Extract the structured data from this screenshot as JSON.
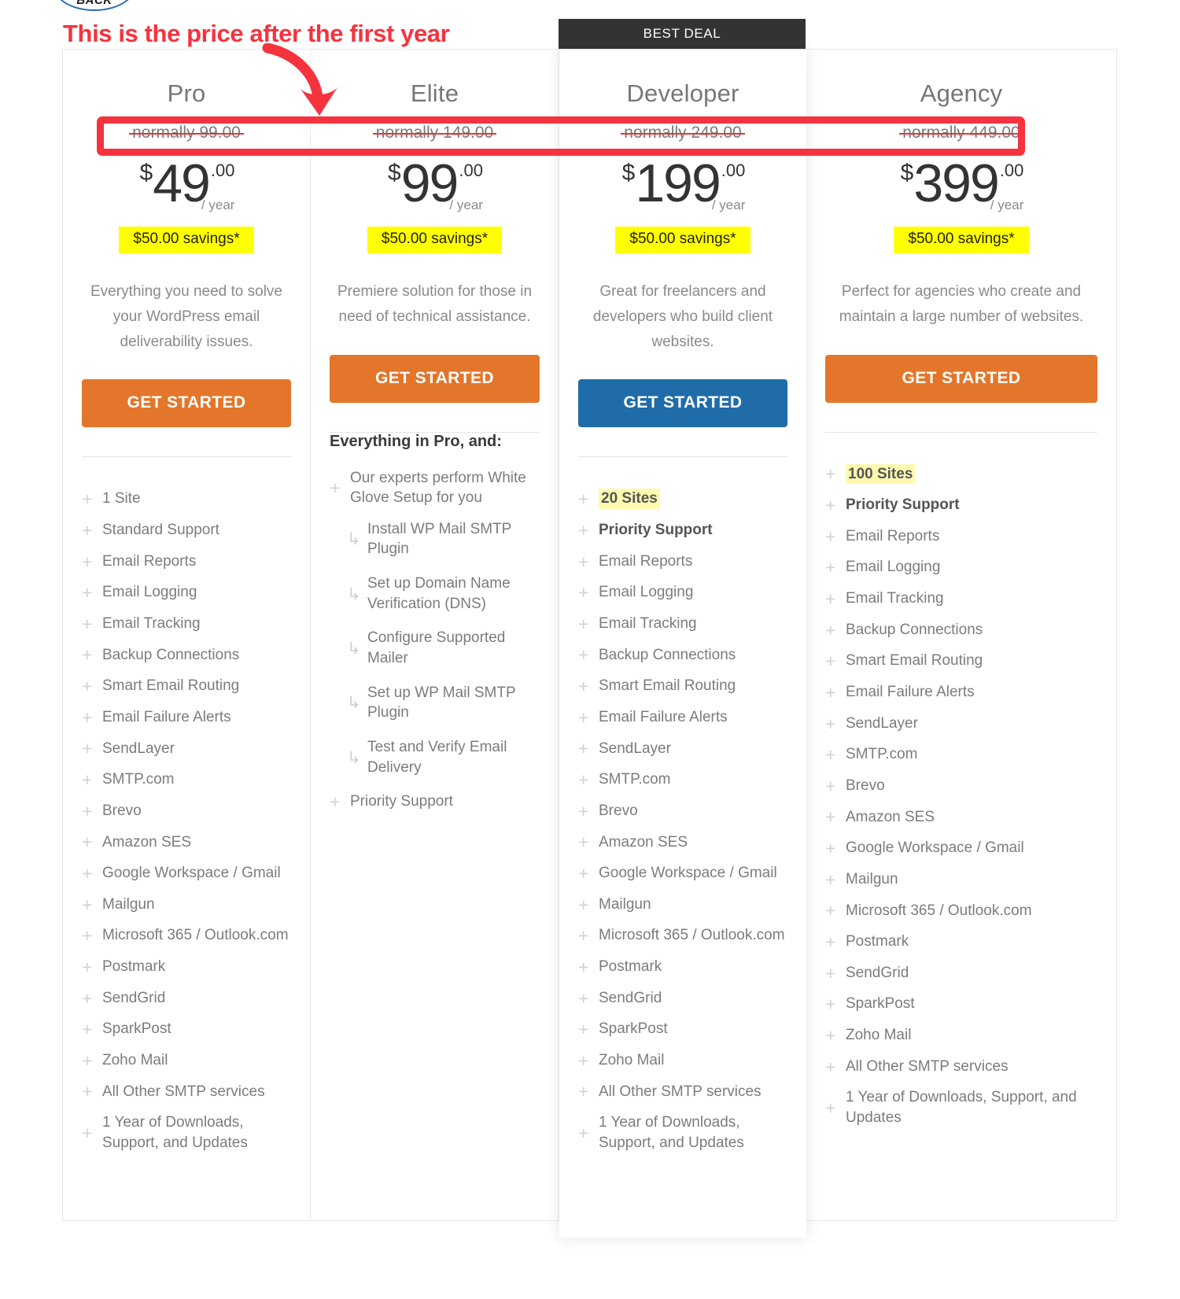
{
  "annotations": {
    "headline": "This is the price after the first year",
    "headline_color": "#f5333f",
    "badge_text": "BACK",
    "arrow_icon": "curved-down-arrow-icon",
    "rect_icon": "highlight-rectangle-icon"
  },
  "best_deal": {
    "label": "BEST DEAL",
    "background": "#333333"
  },
  "colors": {
    "cta_orange": "#e3762b",
    "cta_blue": "#1f6ca8",
    "savings_highlight": "#ffff00",
    "sites_highlight": "#fdfab0",
    "annotation_red": "#f5333f"
  },
  "plans": [
    {
      "name": "Pro",
      "normally": "normally 99.00",
      "currency": "$",
      "amount": "49",
      "cents": ".00",
      "period": "/ year",
      "savings": "$50.00 savings*",
      "description": "Everything you need to solve your WordPress email deliverability issues.",
      "cta_label": "GET STARTED",
      "cta_style": "orange",
      "features_heading": "",
      "features": [
        {
          "text": "1 Site",
          "icon": "plus-icon",
          "style": "normal"
        },
        {
          "text": "Standard Support",
          "icon": "plus-icon",
          "style": "normal"
        },
        {
          "text": "Email Reports",
          "icon": "plus-icon",
          "style": "normal"
        },
        {
          "text": "Email Logging",
          "icon": "plus-icon",
          "style": "normal"
        },
        {
          "text": "Email Tracking",
          "icon": "plus-icon",
          "style": "normal"
        },
        {
          "text": "Backup Connections",
          "icon": "plus-icon",
          "style": "normal"
        },
        {
          "text": "Smart Email Routing",
          "icon": "plus-icon",
          "style": "normal"
        },
        {
          "text": "Email Failure Alerts",
          "icon": "plus-icon",
          "style": "normal"
        },
        {
          "text": "SendLayer",
          "icon": "plus-icon",
          "style": "normal"
        },
        {
          "text": "SMTP.com",
          "icon": "plus-icon",
          "style": "normal"
        },
        {
          "text": "Brevo",
          "icon": "plus-icon",
          "style": "normal"
        },
        {
          "text": "Amazon SES",
          "icon": "plus-icon",
          "style": "normal"
        },
        {
          "text": "Google Workspace / Gmail",
          "icon": "plus-icon",
          "style": "normal"
        },
        {
          "text": "Mailgun",
          "icon": "plus-icon",
          "style": "normal"
        },
        {
          "text": "Microsoft 365 / Outlook.com",
          "icon": "plus-icon",
          "style": "normal"
        },
        {
          "text": "Postmark",
          "icon": "plus-icon",
          "style": "normal"
        },
        {
          "text": "SendGrid",
          "icon": "plus-icon",
          "style": "normal"
        },
        {
          "text": "SparkPost",
          "icon": "plus-icon",
          "style": "normal"
        },
        {
          "text": "Zoho Mail",
          "icon": "plus-icon",
          "style": "normal"
        },
        {
          "text": "All Other SMTP services",
          "icon": "plus-icon",
          "style": "normal"
        },
        {
          "text": "1 Year of Downloads, Support, and Updates",
          "icon": "plus-icon",
          "style": "normal"
        }
      ]
    },
    {
      "name": "Elite",
      "normally": "normally 149.00",
      "currency": "$",
      "amount": "99",
      "cents": ".00",
      "period": "/ year",
      "savings": "$50.00 savings*",
      "description": "Premiere solution for those in need of technical assistance.",
      "cta_label": "GET STARTED",
      "cta_style": "orange",
      "features_heading": "Everything in Pro, and:",
      "features": [
        {
          "text": "Our experts perform White Glove Setup for you",
          "icon": "plus-icon",
          "style": "normal"
        },
        {
          "text": "Install WP Mail SMTP Plugin",
          "icon": "arrow-sub-icon",
          "style": "sub"
        },
        {
          "text": "Set up Domain Name Verification (DNS)",
          "icon": "arrow-sub-icon",
          "style": "sub"
        },
        {
          "text": "Configure Supported Mailer",
          "icon": "arrow-sub-icon",
          "style": "sub"
        },
        {
          "text": "Set up WP Mail SMTP Plugin",
          "icon": "arrow-sub-icon",
          "style": "sub"
        },
        {
          "text": "Test and Verify Email Delivery",
          "icon": "arrow-sub-icon",
          "style": "sub"
        },
        {
          "text": "Priority Support",
          "icon": "plus-icon",
          "style": "normal"
        }
      ]
    },
    {
      "name": "Developer",
      "normally": "normally 249.00",
      "currency": "$",
      "amount": "199",
      "cents": ".00",
      "period": "/ year",
      "savings": "$50.00 savings*",
      "description": "Great for freelancers and developers who build client websites.",
      "cta_label": "GET STARTED",
      "cta_style": "blue",
      "features_heading": "",
      "features": [
        {
          "text": "20 Sites",
          "icon": "plus-icon",
          "style": "highlight"
        },
        {
          "text": "Priority Support",
          "icon": "plus-icon",
          "style": "bold"
        },
        {
          "text": "Email Reports",
          "icon": "plus-icon",
          "style": "normal"
        },
        {
          "text": "Email Logging",
          "icon": "plus-icon",
          "style": "normal"
        },
        {
          "text": "Email Tracking",
          "icon": "plus-icon",
          "style": "normal"
        },
        {
          "text": "Backup Connections",
          "icon": "plus-icon",
          "style": "normal"
        },
        {
          "text": "Smart Email Routing",
          "icon": "plus-icon",
          "style": "normal"
        },
        {
          "text": "Email Failure Alerts",
          "icon": "plus-icon",
          "style": "normal"
        },
        {
          "text": "SendLayer",
          "icon": "plus-icon",
          "style": "normal"
        },
        {
          "text": "SMTP.com",
          "icon": "plus-icon",
          "style": "normal"
        },
        {
          "text": "Brevo",
          "icon": "plus-icon",
          "style": "normal"
        },
        {
          "text": "Amazon SES",
          "icon": "plus-icon",
          "style": "normal"
        },
        {
          "text": "Google Workspace / Gmail",
          "icon": "plus-icon",
          "style": "normal"
        },
        {
          "text": "Mailgun",
          "icon": "plus-icon",
          "style": "normal"
        },
        {
          "text": "Microsoft 365 / Outlook.com",
          "icon": "plus-icon",
          "style": "normal"
        },
        {
          "text": "Postmark",
          "icon": "plus-icon",
          "style": "normal"
        },
        {
          "text": "SendGrid",
          "icon": "plus-icon",
          "style": "normal"
        },
        {
          "text": "SparkPost",
          "icon": "plus-icon",
          "style": "normal"
        },
        {
          "text": "Zoho Mail",
          "icon": "plus-icon",
          "style": "normal"
        },
        {
          "text": "All Other SMTP services",
          "icon": "plus-icon",
          "style": "normal"
        },
        {
          "text": "1 Year of Downloads, Support, and Updates",
          "icon": "plus-icon",
          "style": "normal"
        }
      ]
    },
    {
      "name": "Agency",
      "normally": "normally 449.00",
      "currency": "$",
      "amount": "399",
      "cents": ".00",
      "period": "/ year",
      "savings": "$50.00 savings*",
      "description": "Perfect for agencies who create and maintain a large number of websites.",
      "cta_label": "GET STARTED",
      "cta_style": "orange",
      "features_heading": "",
      "features": [
        {
          "text": "100 Sites",
          "icon": "plus-icon",
          "style": "highlight"
        },
        {
          "text": "Priority Support",
          "icon": "plus-icon",
          "style": "bold"
        },
        {
          "text": "Email Reports",
          "icon": "plus-icon",
          "style": "normal"
        },
        {
          "text": "Email Logging",
          "icon": "plus-icon",
          "style": "normal"
        },
        {
          "text": "Email Tracking",
          "icon": "plus-icon",
          "style": "normal"
        },
        {
          "text": "Backup Connections",
          "icon": "plus-icon",
          "style": "normal"
        },
        {
          "text": "Smart Email Routing",
          "icon": "plus-icon",
          "style": "normal"
        },
        {
          "text": "Email Failure Alerts",
          "icon": "plus-icon",
          "style": "normal"
        },
        {
          "text": "SendLayer",
          "icon": "plus-icon",
          "style": "normal"
        },
        {
          "text": "SMTP.com",
          "icon": "plus-icon",
          "style": "normal"
        },
        {
          "text": "Brevo",
          "icon": "plus-icon",
          "style": "normal"
        },
        {
          "text": "Amazon SES",
          "icon": "plus-icon",
          "style": "normal"
        },
        {
          "text": "Google Workspace / Gmail",
          "icon": "plus-icon",
          "style": "normal"
        },
        {
          "text": "Mailgun",
          "icon": "plus-icon",
          "style": "normal"
        },
        {
          "text": "Microsoft 365 / Outlook.com",
          "icon": "plus-icon",
          "style": "normal"
        },
        {
          "text": "Postmark",
          "icon": "plus-icon",
          "style": "normal"
        },
        {
          "text": "SendGrid",
          "icon": "plus-icon",
          "style": "normal"
        },
        {
          "text": "SparkPost",
          "icon": "plus-icon",
          "style": "normal"
        },
        {
          "text": "Zoho Mail",
          "icon": "plus-icon",
          "style": "normal"
        },
        {
          "text": "All Other SMTP services",
          "icon": "plus-icon",
          "style": "normal"
        },
        {
          "text": "1 Year of Downloads, Support, and Updates",
          "icon": "plus-icon",
          "style": "normal"
        }
      ]
    }
  ]
}
